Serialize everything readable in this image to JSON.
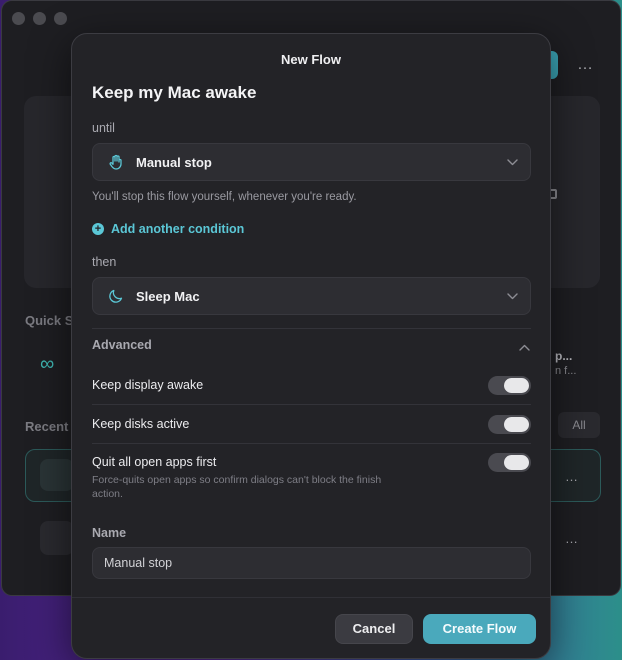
{
  "background_window": {
    "quick_section_label": "Quick S",
    "quick_item_title": "p...",
    "quick_item_subtitle": "n f...",
    "recent_section_label": "Recent",
    "filter_all_label": "All",
    "more_label": "…",
    "row_more_label": "…"
  },
  "sheet": {
    "title": "New Flow",
    "heading": "Keep my Mac awake",
    "until_label": "until",
    "until_select": {
      "icon": "hand-icon",
      "value": "Manual stop"
    },
    "until_hint": "You'll stop this flow yourself, whenever you're ready.",
    "add_condition_label": "Add another condition",
    "then_label": "then",
    "then_select": {
      "icon": "moon-icon",
      "value": "Sleep Mac"
    },
    "advanced_label": "Advanced",
    "options": [
      {
        "label": "Keep display awake",
        "on": true
      },
      {
        "label": "Keep disks active",
        "on": true
      },
      {
        "label": "Quit all open apps first",
        "on": true
      }
    ],
    "quit_hint": "Force-quits open apps so confirm dialogs can't block the finish action.",
    "name_label": "Name",
    "name_value": "Manual stop",
    "cancel_label": "Cancel",
    "create_label": "Create Flow"
  },
  "colors": {
    "accent": "#5bc7d6",
    "primary_button": "#4aa9bc",
    "sheet_bg": "#232327"
  }
}
